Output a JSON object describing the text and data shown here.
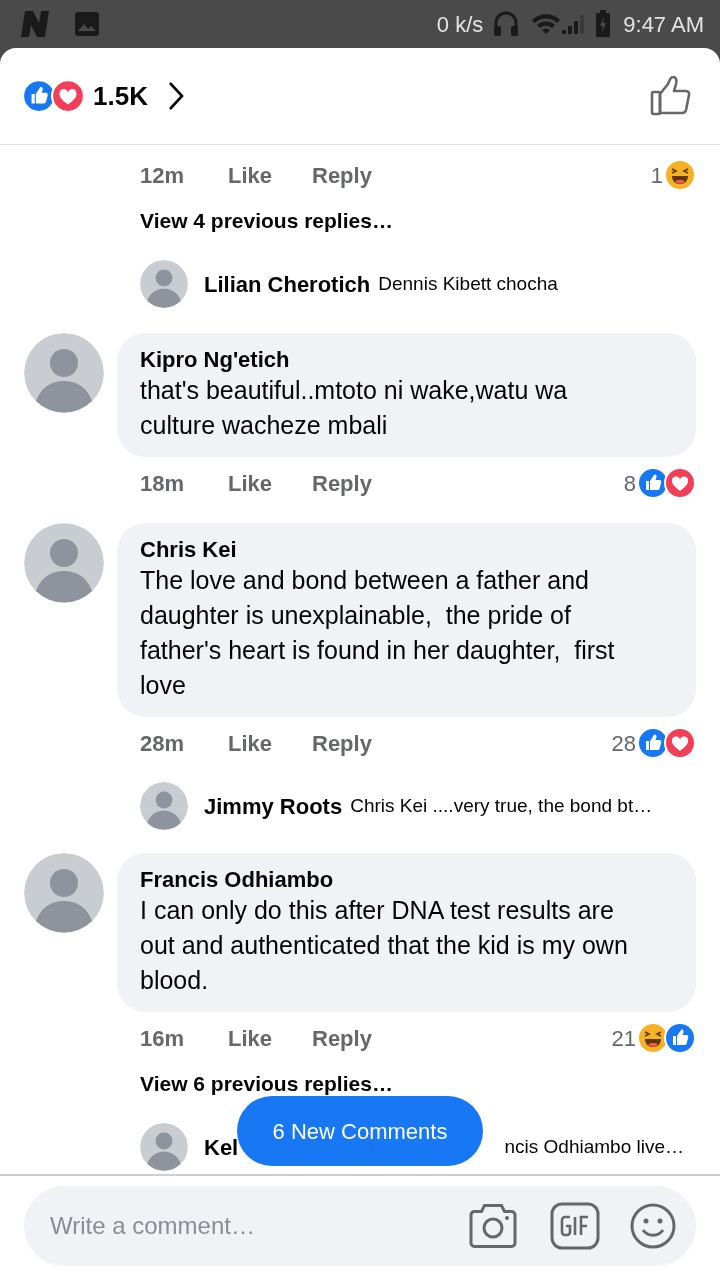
{
  "status_bar": {
    "speed": "0 k/s",
    "time": "9:47 AM"
  },
  "header": {
    "reactions": [
      {
        "kind": "like"
      },
      {
        "kind": "love"
      }
    ],
    "count": "1.5K"
  },
  "items": [
    {
      "kind": "actions",
      "time": "12m",
      "like": "Like",
      "reply": "Reply",
      "count": "1",
      "reactions": [
        {
          "kind": "haha"
        }
      ]
    },
    {
      "kind": "view_more",
      "text": "View 4 previous replies…"
    },
    {
      "kind": "reply",
      "name": "Lilian Cherotich",
      "text": "Dennis Kibett chocha"
    },
    {
      "kind": "comment",
      "name": "Kipro Ng'etich",
      "text": "that's beautiful..mtoto ni wake,watu wa culture wacheze mbali",
      "time": "18m",
      "like": "Like",
      "reply": "Reply",
      "count": "8",
      "reactions": [
        {
          "kind": "like"
        },
        {
          "kind": "love"
        }
      ]
    },
    {
      "kind": "comment",
      "name": "Chris Kei",
      "text": "The love and bond between a father and daughter is unexplainable,  the pride of father's heart is found in her daughter,  first love",
      "time": "28m",
      "like": "Like",
      "reply": "Reply",
      "count": "28",
      "reactions": [
        {
          "kind": "like"
        },
        {
          "kind": "love"
        }
      ]
    },
    {
      "kind": "reply",
      "name": "Jimmy Roots",
      "text": "Chris Kei ....very true, the bond bt…"
    },
    {
      "kind": "comment",
      "name": "Francis Odhiambo",
      "text": "I can only do this after DNA test results are out and authenticated that the kid is my own blood.",
      "time": "16m",
      "like": "Like",
      "reply": "Reply",
      "count": "21",
      "reactions": [
        {
          "kind": "haha"
        },
        {
          "kind": "like"
        }
      ]
    },
    {
      "kind": "view_more",
      "text": "View 6 previous replies…"
    },
    {
      "kind": "reply_covered",
      "name": "Kel",
      "text": "ncis Odhiambo live…"
    }
  ],
  "new_comments_button": "6 New Comments",
  "composer": {
    "placeholder": "Write a comment…"
  }
}
